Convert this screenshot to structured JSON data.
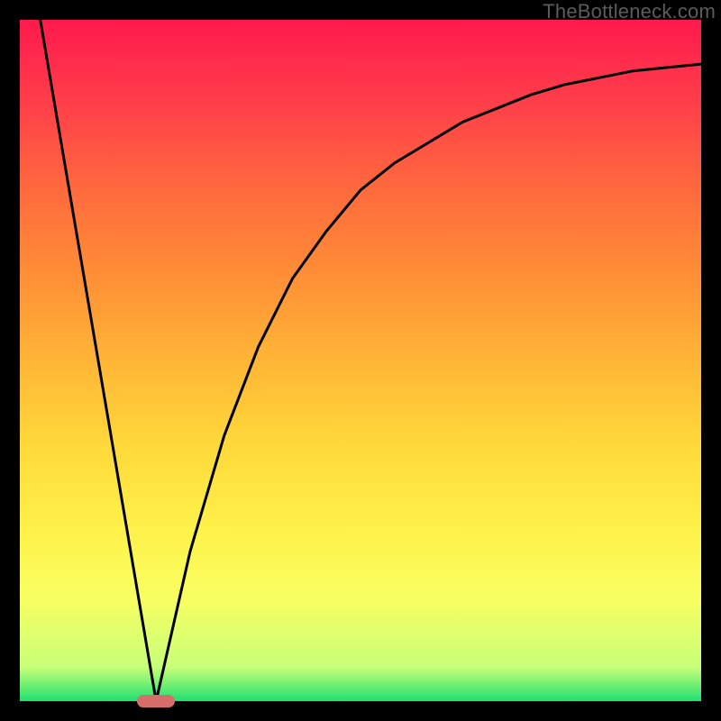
{
  "watermark": "TheBottleneck.com",
  "chart_data": {
    "type": "line",
    "title": "",
    "xlabel": "",
    "ylabel": "",
    "xlim": [
      0,
      100
    ],
    "ylim": [
      0,
      100
    ],
    "grid": false,
    "legend": false,
    "series": [
      {
        "name": "left-line",
        "x": [
          3,
          20
        ],
        "y": [
          100,
          0
        ]
      },
      {
        "name": "right-curve",
        "x": [
          20,
          25,
          30,
          35,
          40,
          45,
          50,
          55,
          60,
          65,
          70,
          75,
          80,
          85,
          90,
          95,
          100
        ],
        "y": [
          0,
          22,
          39,
          52,
          62,
          69,
          75,
          79,
          82,
          85,
          87,
          89,
          90.5,
          91.5,
          92.5,
          93,
          93.5
        ]
      }
    ],
    "marker": {
      "x": 20,
      "y": 0,
      "label": "optimal-point"
    },
    "gradient_stops": [
      {
        "pos": 0,
        "color": "#ff1a4d"
      },
      {
        "pos": 50,
        "color": "#ffb536"
      },
      {
        "pos": 85,
        "color": "#f8ff62"
      },
      {
        "pos": 100,
        "color": "#20e070"
      }
    ]
  }
}
